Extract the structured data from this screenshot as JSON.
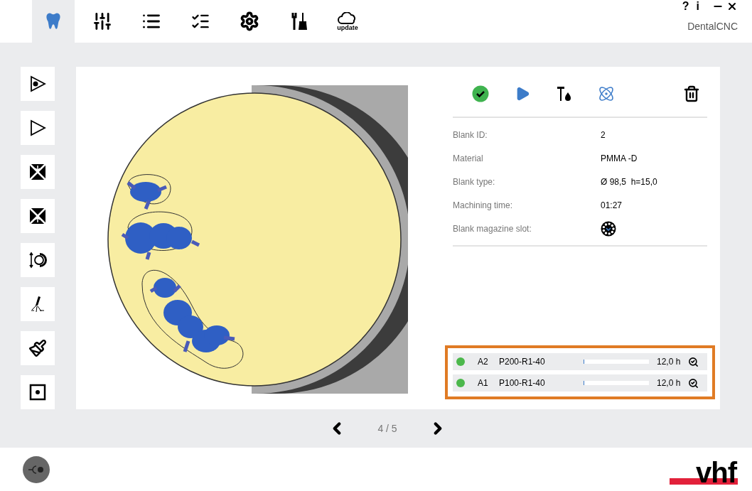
{
  "toolbar": {
    "tabs": [
      {
        "kind": "tooth",
        "selected": true
      },
      {
        "kind": "sliders",
        "selected": false
      },
      {
        "kind": "list",
        "selected": false
      },
      {
        "kind": "checklist",
        "selected": false
      },
      {
        "kind": "gear",
        "selected": false
      },
      {
        "kind": "tools",
        "selected": false
      },
      {
        "kind": "cloud",
        "label": "update",
        "selected": false
      }
    ]
  },
  "window": {
    "help": "?",
    "info": "i",
    "title": "DentalCNC"
  },
  "sidebar": {
    "buttons": [
      {
        "kind": "play-dot"
      },
      {
        "kind": "play"
      },
      {
        "kind": "clamp-down"
      },
      {
        "kind": "clamp-up"
      },
      {
        "kind": "blank-rotate"
      },
      {
        "kind": "spray"
      },
      {
        "kind": "brush"
      },
      {
        "kind": "square-dot"
      }
    ]
  },
  "actions": [
    {
      "kind": "ok"
    },
    {
      "kind": "play"
    },
    {
      "kind": "tool-liquid"
    },
    {
      "kind": "atom"
    },
    {
      "kind": "trash"
    }
  ],
  "details": [
    {
      "label": "Blank ID:",
      "value": "2"
    },
    {
      "label": "Material",
      "value": "PMMA -D"
    },
    {
      "label": "Blank type:",
      "value": "Ø 98,5  h=15,0"
    },
    {
      "label": "Machining time:",
      "value": "01:27"
    },
    {
      "label": "Blank magazine slot:",
      "kind": "slot-icon"
    }
  ],
  "jobs": [
    {
      "color": "#4cb84c",
      "slot": "A2",
      "tool": "P200-R1-40",
      "level": 0.01,
      "time": "12,0 h"
    },
    {
      "color": "#4cb84c",
      "slot": "A1",
      "tool": "P100-R1-40",
      "level": 0.01,
      "time": "12,0 h"
    }
  ],
  "pager": {
    "text": "4 / 5"
  },
  "footer": {
    "logo": "vhf"
  }
}
